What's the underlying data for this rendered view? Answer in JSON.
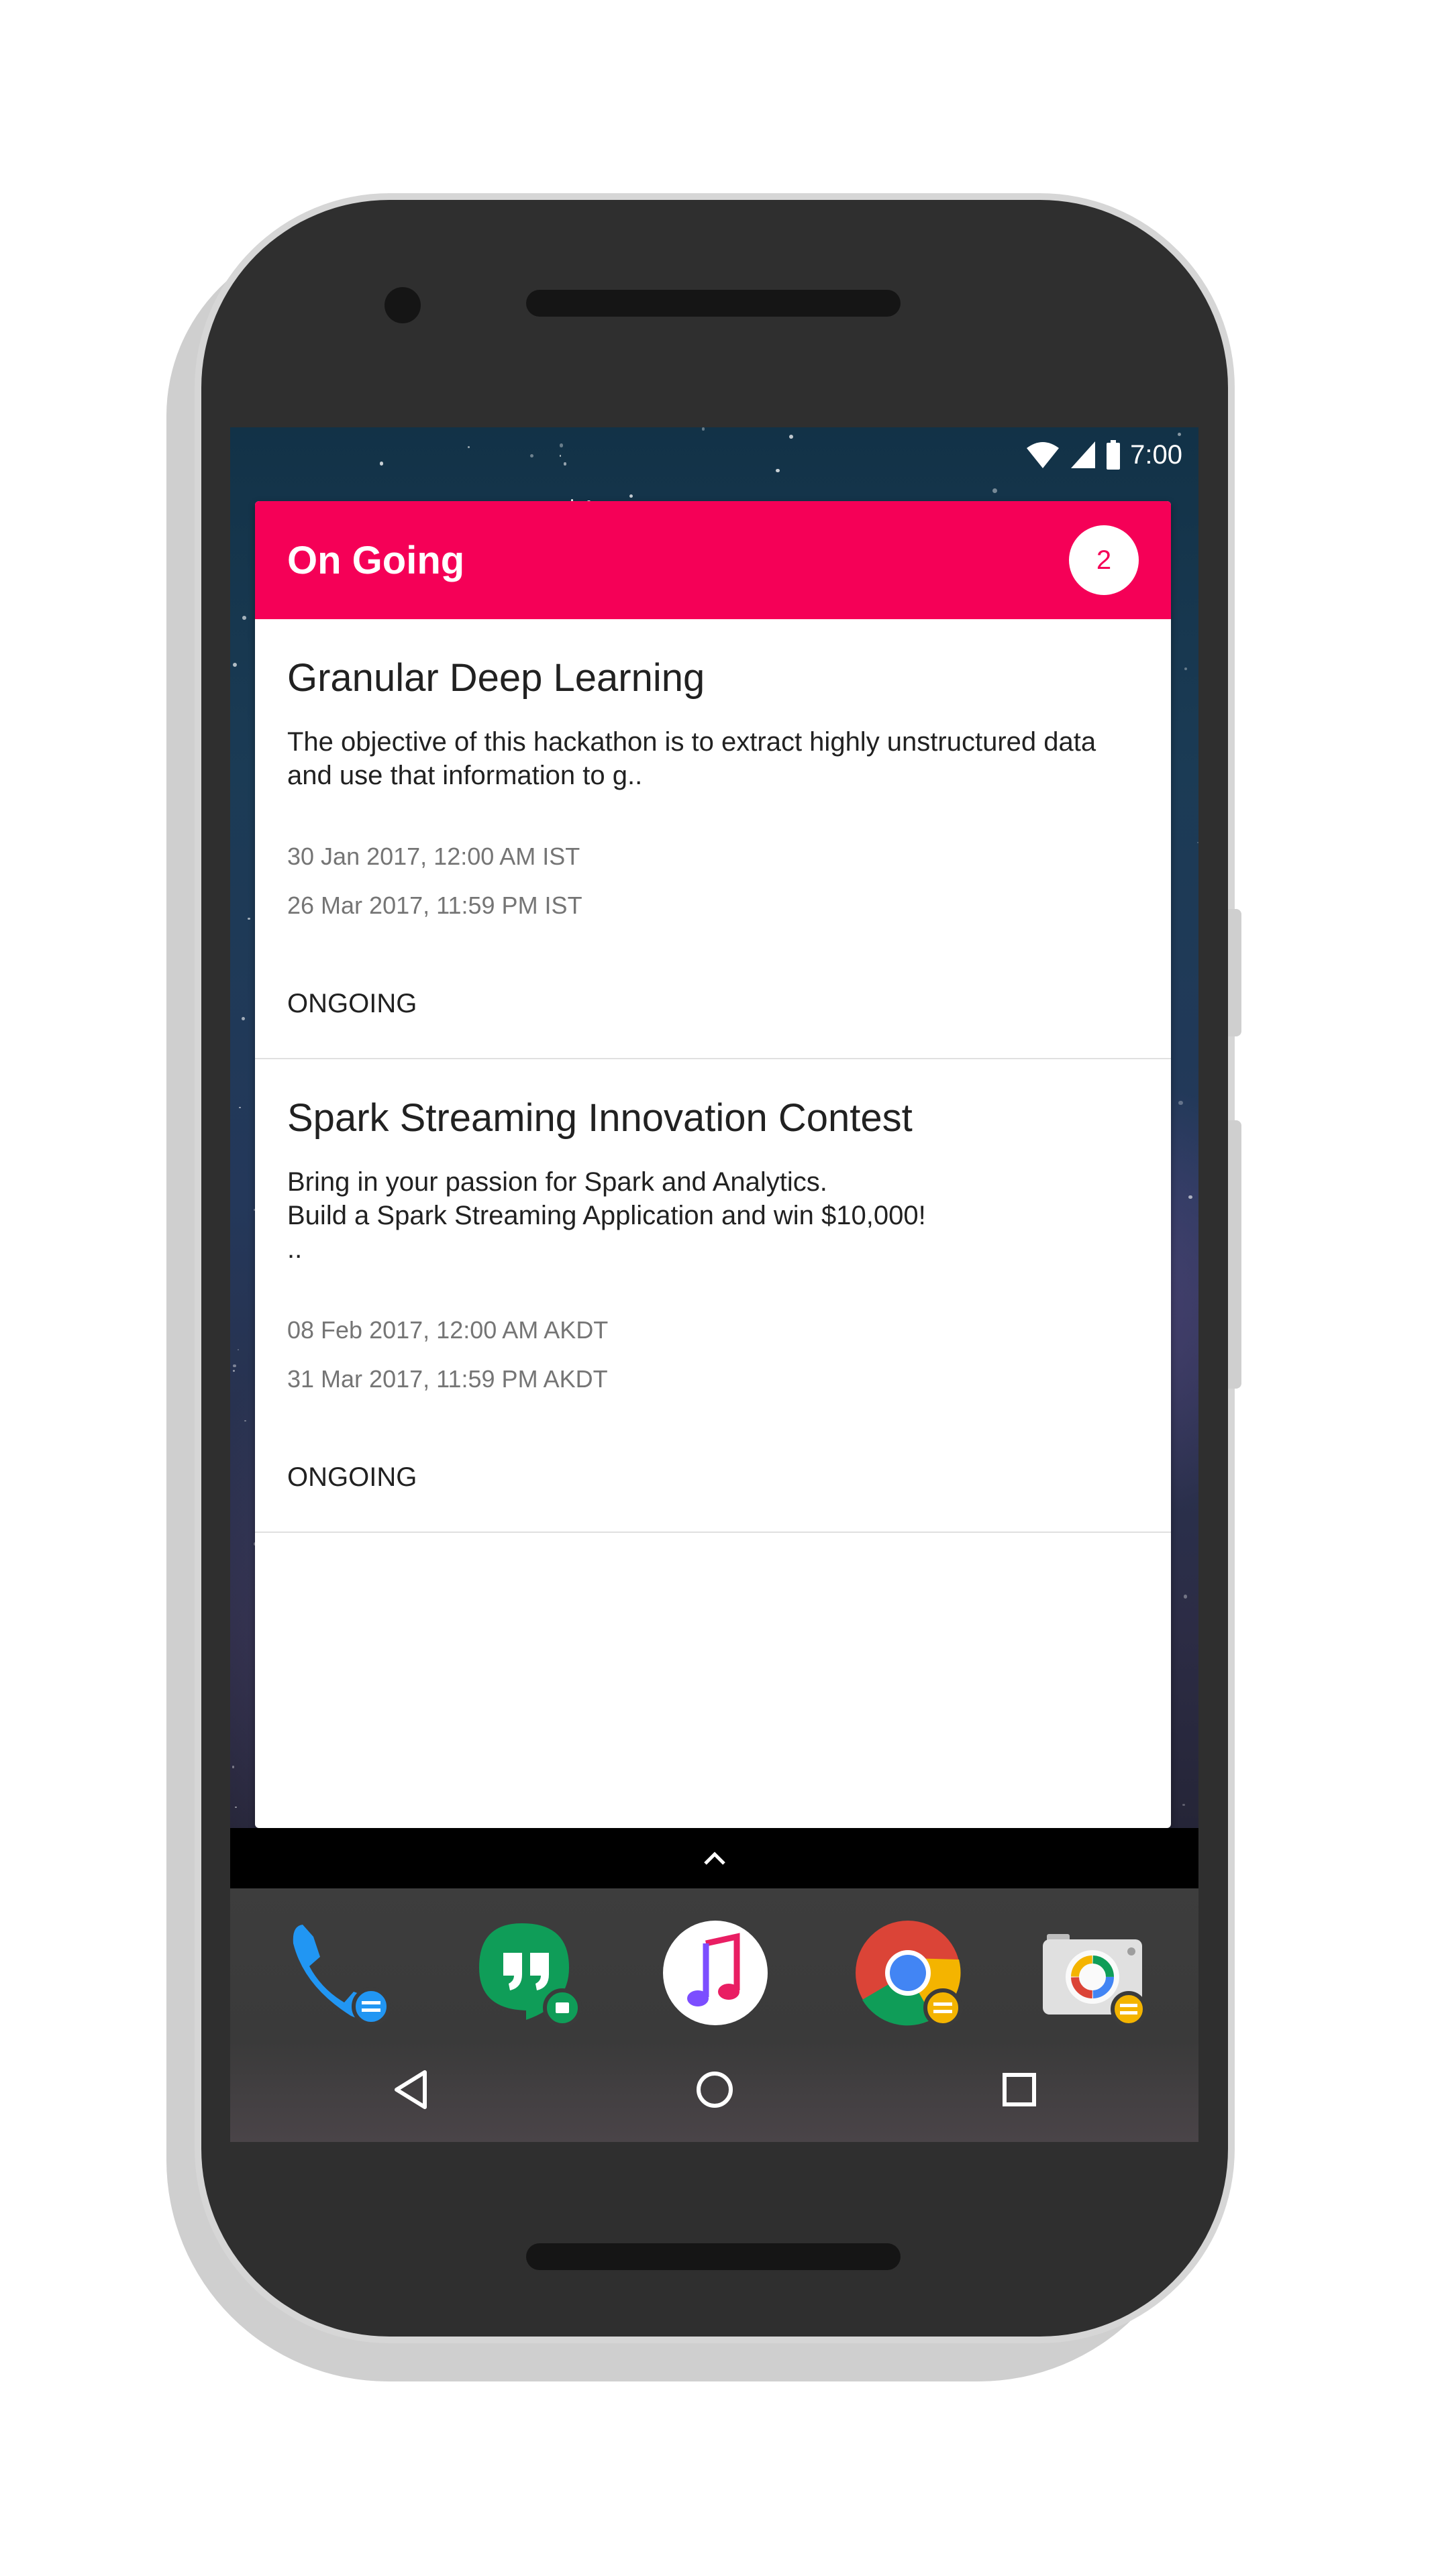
{
  "status_bar": {
    "time": "7:00",
    "icons": [
      "wifi-icon",
      "cell-signal-icon",
      "battery-icon"
    ]
  },
  "widget": {
    "title": "On Going",
    "count": "2",
    "accent_color": "#f50057"
  },
  "cards": [
    {
      "title": "Granular Deep Learning",
      "description": "The objective of this hackathon is to extract highly unstructured data and use that information to g..",
      "start": "30 Jan 2017, 12:00 AM IST",
      "end": "26 Mar 2017, 11:59 PM IST",
      "status": "ONGOING"
    },
    {
      "title": "Spark Streaming Innovation Contest",
      "description": "Bring in your passion for Spark and Analytics.\nBuild a Spark Streaming Application and win $10,000!\n..",
      "start": "08 Feb 2017, 12:00 AM AKDT",
      "end": "31 Mar 2017, 11:59 PM AKDT",
      "status": "ONGOING"
    }
  ],
  "dock": {
    "apps": [
      "phone-app-icon",
      "hangouts-app-icon",
      "music-app-icon",
      "chrome-app-icon",
      "camera-app-icon"
    ]
  },
  "navigation": {
    "buttons": [
      "back-icon",
      "home-icon",
      "recents-icon"
    ]
  }
}
